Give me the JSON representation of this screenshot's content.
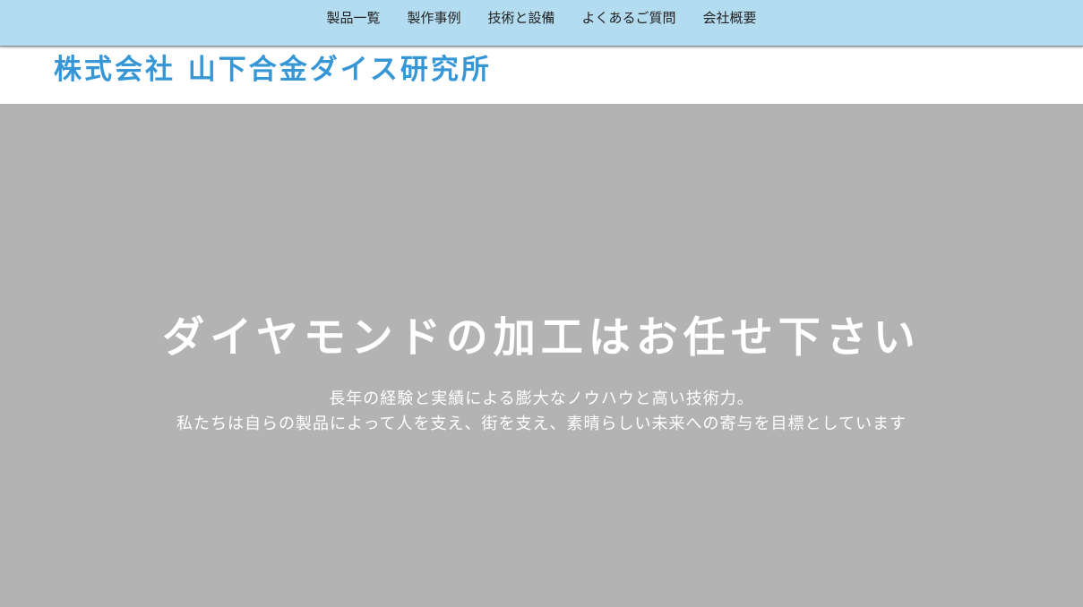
{
  "nav": {
    "items": [
      {
        "label": "製品一覧"
      },
      {
        "label": "製作事例"
      },
      {
        "label": "技術と設備"
      },
      {
        "label": "よくあるご質問"
      },
      {
        "label": "会社概要"
      }
    ]
  },
  "header": {
    "company_name": "株式会社 山下合金ダイス研究所"
  },
  "hero": {
    "title": "ダイヤモンドの加工はお任せ下さい",
    "lines": [
      "長年の経験と実績による膨大なノウハウと高い技術力。",
      "私たちは自らの製品によって人を支え、街を支え、素晴らしい未来への寄与を目標としています"
    ],
    "background_color": "#b3b3b3"
  },
  "colors": {
    "nav_background": "#b3dcf0",
    "brand": "#3797d6"
  }
}
